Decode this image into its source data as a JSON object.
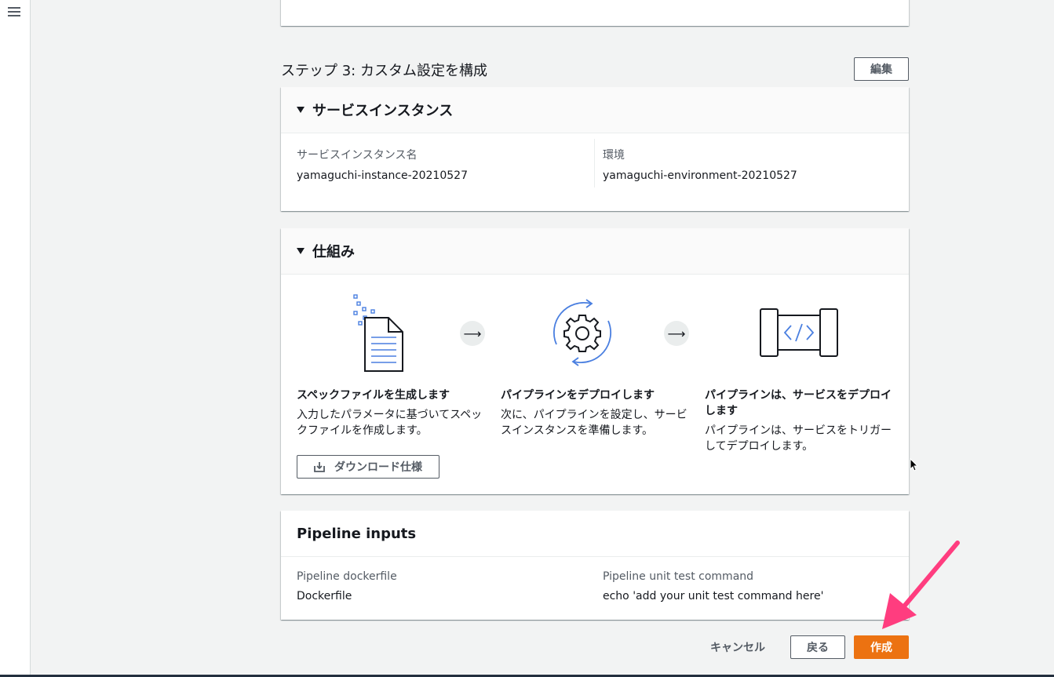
{
  "nav": {
    "menu_icon": "hamburger-icon"
  },
  "step3": {
    "title": "ステップ 3: カスタム設定を構成",
    "edit_label": "編集"
  },
  "service_instance": {
    "header": "サービスインスタンス",
    "name_label": "サービスインスタンス名",
    "name_value": "yamaguchi-instance-20210527",
    "env_label": "環境",
    "env_value": "yamaguchi-environment-20210527"
  },
  "how_it_works": {
    "header": "仕組み",
    "steps": [
      {
        "icon": "spec-file-icon",
        "title": "スペックファイルを生成します",
        "desc_lines": [
          "入力したパラメータに基づいてスペッ",
          "クファイルを作成します。"
        ]
      },
      {
        "icon": "deploy-gear-icon",
        "title": "パイプラインをデプロイします",
        "desc_lines": [
          "次に、パイプラインを設定し、サービ",
          "スインスタンスを準備します。"
        ]
      },
      {
        "icon": "pipeline-code-icon",
        "title_lines": [
          "パイプラインは、サービスをデプロイ",
          "します"
        ],
        "desc_lines": [
          "パイプラインは、サービスをトリガー",
          "してデプロイします。"
        ]
      }
    ],
    "arrow_glyph": "⟶",
    "download_label": "ダウンロード仕様"
  },
  "pipeline_inputs": {
    "header": "Pipeline inputs",
    "dockerfile_label": "Pipeline dockerfile",
    "dockerfile_value": "Dockerfile",
    "unit_test_label": "Pipeline unit test command",
    "unit_test_value": "echo 'add your unit test command here'"
  },
  "footer": {
    "cancel_label": "キャンセル",
    "back_label": "戻る",
    "create_label": "作成"
  },
  "colors": {
    "primary": "#ec7211",
    "link": "#0073bb",
    "annotation": "#ff3d7f"
  }
}
